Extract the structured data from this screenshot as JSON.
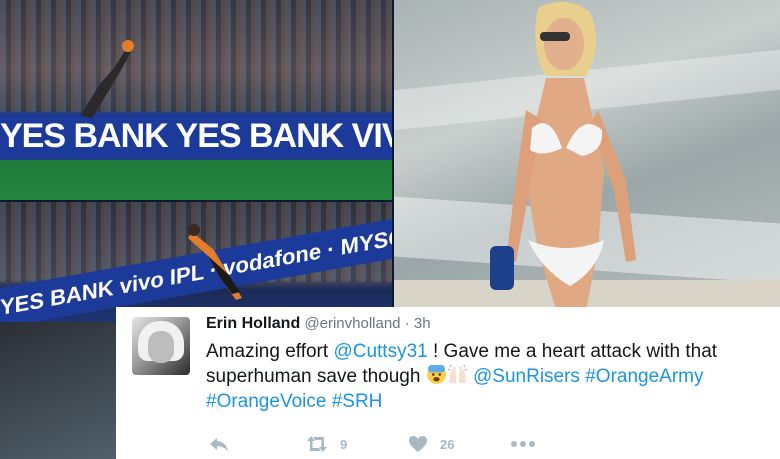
{
  "photos": {
    "top_adboard": "YES BANK YES BANK VIVO IPL",
    "bottom_adboard": "YES BANK vivo IPL · vodafone · MYSO"
  },
  "tweet": {
    "display_name": "Erin Holland",
    "handle": "@erinvholland",
    "separator": "·",
    "time": "3h",
    "text_part1": "Amazing effort ",
    "mention1": "@Cuttsy31",
    "text_part2": " ! Gave me a heart attack with that superhuman save though ",
    "mention2": "@SunRisers",
    "hashtag1": "#OrangeArmy",
    "hashtag2": "#OrangeVoice",
    "hashtag3": "#SRH",
    "retweet_count": "9",
    "like_count": "26"
  },
  "colors": {
    "link": "#1b95e0",
    "action_gray": "#aab8c2"
  },
  "icons": [
    "reply-icon",
    "retweet-icon",
    "heart-icon",
    "more-icon",
    "fearful-face-emoji",
    "raised-hands-emoji"
  ]
}
